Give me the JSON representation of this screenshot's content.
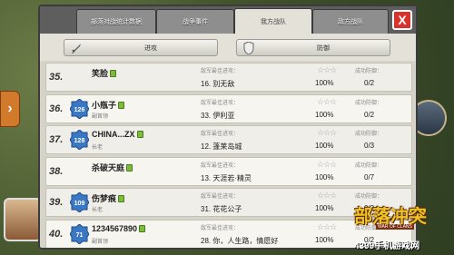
{
  "tabs": [
    {
      "label": "部落对战统计数据",
      "active": false
    },
    {
      "label": "战争事件",
      "active": false
    },
    {
      "label": "我方战队",
      "active": true
    },
    {
      "label": "敌方战队",
      "active": false
    }
  ],
  "close_label": "X",
  "subbar": {
    "attack_label": "进攻",
    "defense_label": "防御"
  },
  "labels": {
    "best_attack": "敌军最佳进攻：",
    "success_defense": "成功防御："
  },
  "rows": [
    {
      "rank": "35.",
      "level": "",
      "name": "笑脸",
      "role": "",
      "best": "16. 别无敌",
      "stars": "☆☆☆",
      "percent": "100%",
      "defense": "0/2"
    },
    {
      "rank": "36.",
      "level": "126",
      "name": "小瓶子",
      "role": "副首领",
      "best": "33. 伊利亚",
      "stars": "☆☆☆",
      "percent": "100%",
      "defense": "0/2"
    },
    {
      "rank": "37.",
      "level": "128",
      "name": "CHINA...ZX",
      "role": "长老",
      "best": "12. 蓬莱岛城",
      "stars": "☆☆☆",
      "percent": "100%",
      "defense": "0/3"
    },
    {
      "rank": "38.",
      "level": "",
      "name": "杀破天庭",
      "role": "",
      "best": "13. 天涯若·精灵",
      "stars": "☆☆☆",
      "percent": "100%",
      "defense": "0/7"
    },
    {
      "rank": "39.",
      "level": "109",
      "name": "伤梦痕",
      "role": "长老",
      "best": "31. 花花公子",
      "stars": "☆☆☆",
      "percent": "100%",
      "defense": "0/2"
    },
    {
      "rank": "40.",
      "level": "71",
      "name": "1234567890",
      "role": "副首领",
      "best": "28. 你，人生路，情愿好",
      "stars": "☆☆☆",
      "percent": "100%",
      "defense": "0/2"
    }
  ],
  "logo": {
    "title": "部落冲突",
    "subtitle": "WAR OF CLANS",
    "site": "4399手机游戏网"
  },
  "colors": {
    "accent_close": "#d8322d",
    "townhall": "#7dbb3a",
    "level_badge": "#3b78c4"
  }
}
